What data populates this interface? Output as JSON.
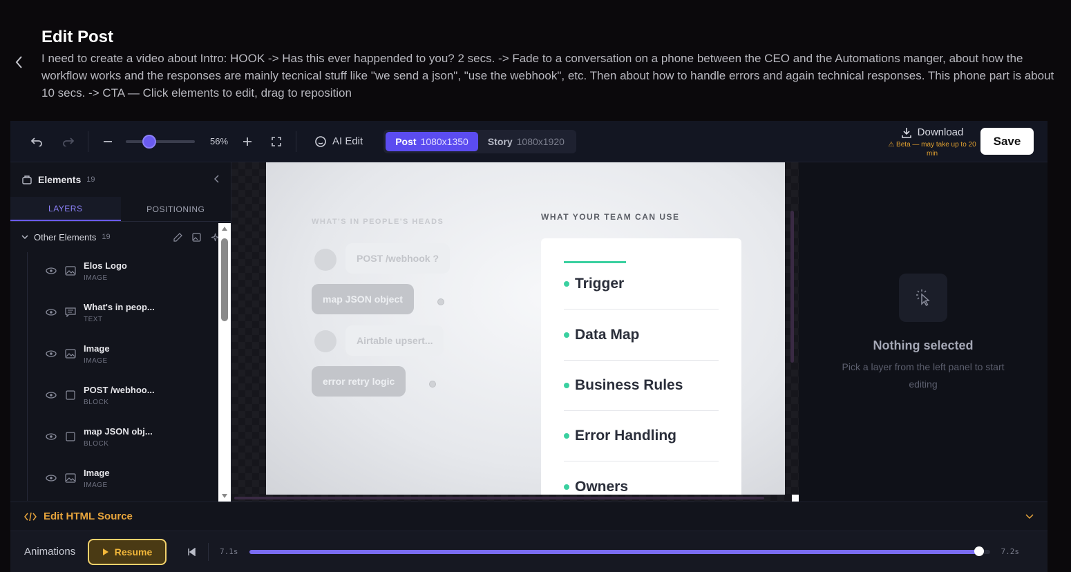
{
  "page": {
    "title": "Edit Post",
    "description": "I need to create a video about Intro: HOOK -> Has this ever happended to you? 2 secs. -> Fade to a conversation on a phone between the CEO and the Automations manger, about how the workflow works and the responses are mainly tecnical stuff like \"we send a json\", \"use the webhook\", etc. Then about how to handle errors and again technical responses. This phone part is about 10 secs. -> CTA — Click elements to edit, drag to reposition"
  },
  "toolbar": {
    "zoom": "56%",
    "zoom_fraction": 0.3,
    "ai_edit": "AI Edit",
    "formats": [
      {
        "label": "Post",
        "size": "1080x1350",
        "active": true
      },
      {
        "label": "Story",
        "size": "1080x1920",
        "active": false
      }
    ],
    "download_label": "Download",
    "download_note": "⚠ Beta — may take up to 20 min",
    "save_label": "Save"
  },
  "elements_panel": {
    "title": "Elements",
    "count": "19",
    "tabs": [
      "LAYERS",
      "POSITIONING"
    ],
    "group": {
      "name": "Other Elements",
      "count": "19"
    },
    "layers": [
      {
        "name": "Elos Logo",
        "type": "IMAGE",
        "icon": "image-icon"
      },
      {
        "name": "What's in peop...",
        "type": "TEXT",
        "icon": "text-icon"
      },
      {
        "name": "Image",
        "type": "IMAGE",
        "icon": "image-icon"
      },
      {
        "name": "POST /webhoo...",
        "type": "BLOCK",
        "icon": "block-icon"
      },
      {
        "name": "map JSON obj...",
        "type": "BLOCK",
        "icon": "block-icon"
      },
      {
        "name": "Image",
        "type": "IMAGE",
        "icon": "image-icon"
      }
    ]
  },
  "canvas": {
    "heads_label": "WHAT'S IN PEOPLE'S HEADS",
    "bubbles": [
      {
        "text": "POST /webhook ?",
        "style": "light"
      },
      {
        "text": "map JSON object",
        "style": "dark"
      },
      {
        "text": "Airtable upsert...",
        "style": "light"
      },
      {
        "text": "error retry logic",
        "style": "dark"
      }
    ],
    "team_label": "WHAT YOUR TEAM CAN USE",
    "team_items": [
      "Trigger",
      "Data Map",
      "Business Rules",
      "Error Handling",
      "Owners"
    ],
    "accent_color": "#3ad0a0"
  },
  "inspector": {
    "title": "Nothing selected",
    "description": "Pick a layer from the left panel to start editing"
  },
  "html_source": {
    "label": "Edit HTML Source"
  },
  "animations": {
    "label": "Animations",
    "resume_label": "Resume",
    "current_time": "7.1s",
    "end_time": "7.2s",
    "progress": 0.986
  },
  "colors": {
    "brand": "#5b4cf0",
    "warning": "#e8a53c"
  }
}
